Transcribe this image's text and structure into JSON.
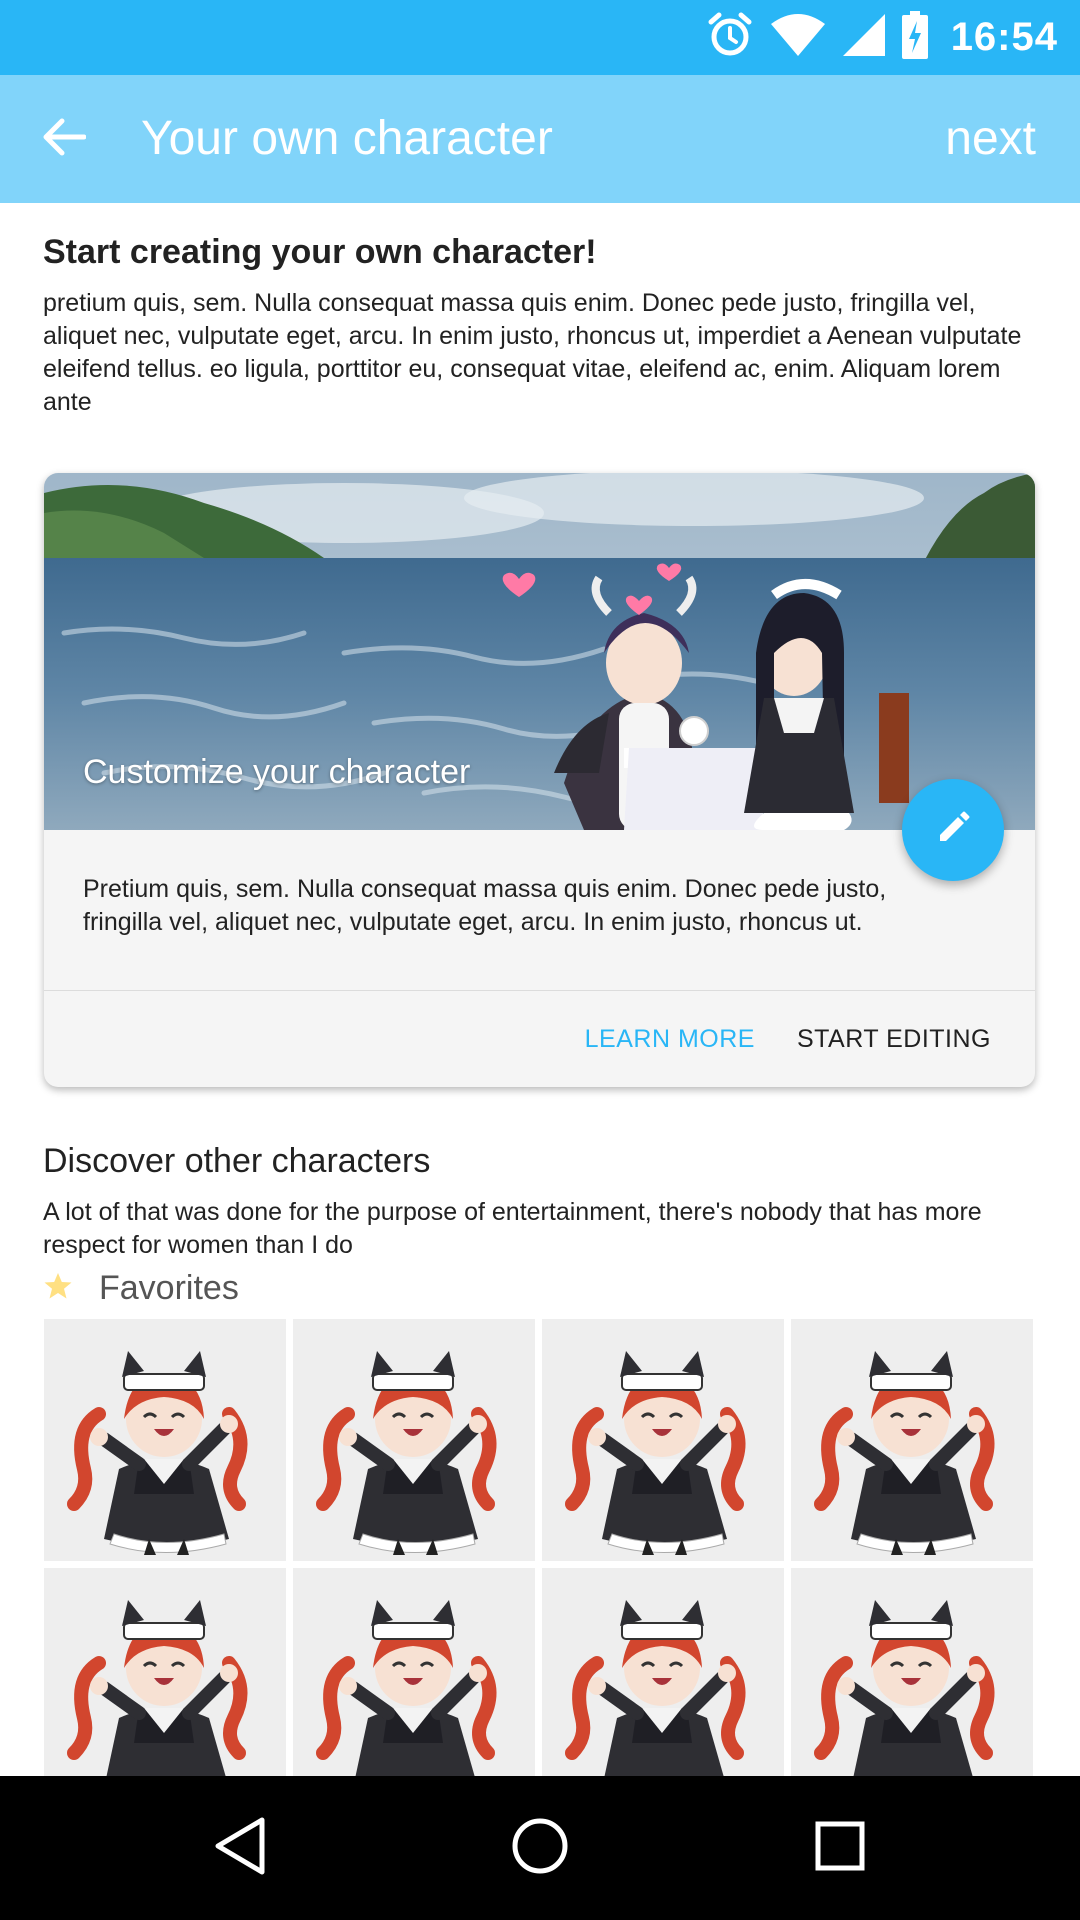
{
  "status_bar": {
    "time": "16:54",
    "icons": [
      "alarm-icon",
      "wifi-icon",
      "signal-icon",
      "battery-charging-icon"
    ]
  },
  "app_bar": {
    "title": "Your own character",
    "action_label": "next",
    "back_icon": "arrow-back-icon"
  },
  "intro": {
    "heading": "Start creating your own character!",
    "body": "pretium quis, sem. Nulla consequat massa quis enim. Donec pede justo, fringilla vel, aliquet nec, vulputate eget, arcu. In enim justo, rhoncus ut, imperdiet a Aenean vulputate eleifend tellus. eo ligula, porttitor eu, consequat vitae, eleifend ac, enim. Aliquam lorem ante"
  },
  "card": {
    "title": "Customize your character",
    "body": "Pretium quis, sem. Nulla consequat massa quis enim. Donec pede justo, fringilla vel, aliquet nec, vulputate eget, arcu. In enim justo, rhoncus ut.",
    "learn_more_label": "LEARN MORE",
    "start_editing_label": "START EDITING",
    "fab_icon": "edit-pencil-icon"
  },
  "discover": {
    "heading": "Discover other characters",
    "body": "A lot of that was done for the purpose of entertainment, there's nobody that has more respect for women than I do"
  },
  "favorites": {
    "label": "Favorites",
    "icon": "star-icon",
    "tiles": [
      "character-thumbnail",
      "character-thumbnail",
      "character-thumbnail",
      "character-thumbnail",
      "character-thumbnail",
      "character-thumbnail",
      "character-thumbnail",
      "character-thumbnail"
    ]
  },
  "colors": {
    "status_bar": "#29b6f6",
    "app_bar": "#81d4fa",
    "accent": "#29b6f6",
    "star": "#ffe082"
  },
  "nav_bar": {
    "buttons": [
      "back-triangle-icon",
      "home-circle-icon",
      "recents-square-icon"
    ]
  }
}
